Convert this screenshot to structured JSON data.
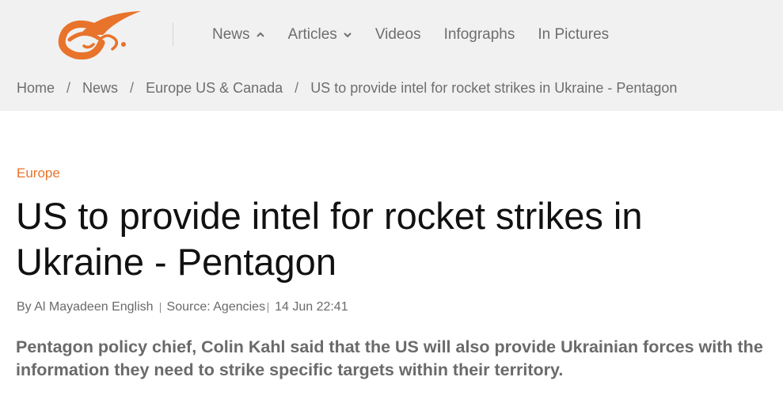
{
  "header": {
    "logo_icon": "al-mayadeen-logo",
    "accent_color": "#e8732b",
    "nav": [
      {
        "label": "News",
        "icon": "chevron-up-icon"
      },
      {
        "label": "Articles",
        "icon": "chevron-down-icon"
      },
      {
        "label": "Videos"
      },
      {
        "label": "Infographs"
      },
      {
        "label": "In Pictures"
      }
    ]
  },
  "breadcrumb": {
    "items": [
      "Home",
      "News",
      "Europe US & Canada",
      "US to provide intel for rocket strikes in Ukraine - Pentagon"
    ],
    "separator": "/"
  },
  "article": {
    "category": "Europe",
    "title": "US to provide intel for rocket strikes in Ukraine - Pentagon",
    "author": "By Al Mayadeen English",
    "source": "Source: Agencies",
    "date": "14 Jun 22:41",
    "summary": "Pentagon policy chief, Colin Kahl said that the US will also provide Ukrainian forces with the information they need to strike specific targets within their territory."
  }
}
